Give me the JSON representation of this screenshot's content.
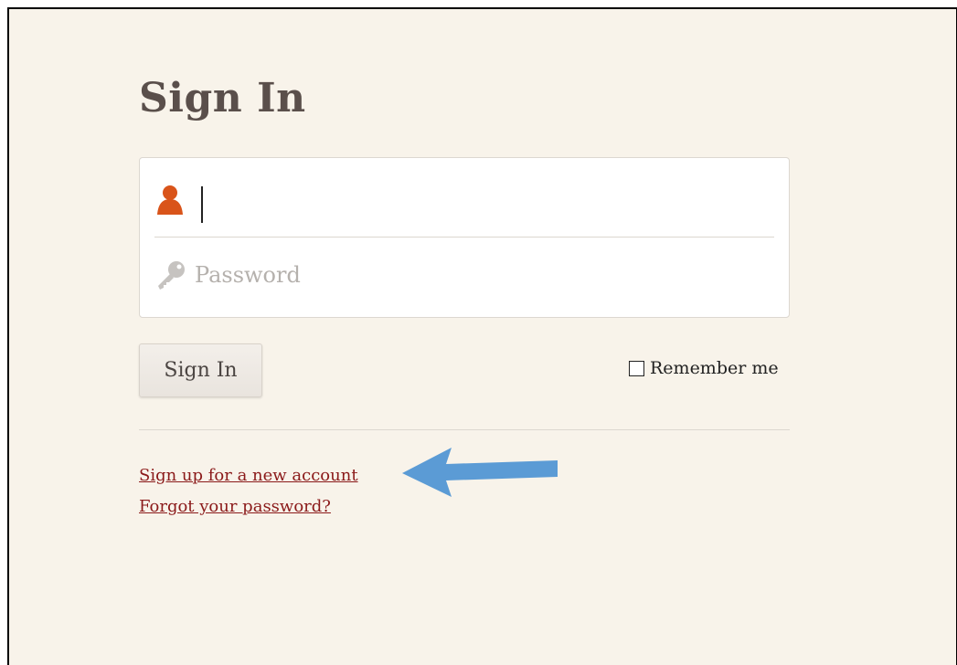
{
  "page": {
    "title": "Sign In"
  },
  "form": {
    "username": {
      "value": "",
      "placeholder": "",
      "icon": "user-icon"
    },
    "password": {
      "value": "",
      "placeholder": "Password",
      "icon": "key-icon"
    },
    "submit_label": "Sign In",
    "remember_label": "Remember me",
    "remember_checked": false
  },
  "links": {
    "signup": "Sign up for a new account",
    "forgot": "Forgot your password?"
  },
  "colors": {
    "background": "#f8f3ea",
    "user_icon": "#d9541a",
    "key_icon": "#c6c3c0",
    "link": "#8b1a1a",
    "arrow": "#5b9bd5"
  }
}
